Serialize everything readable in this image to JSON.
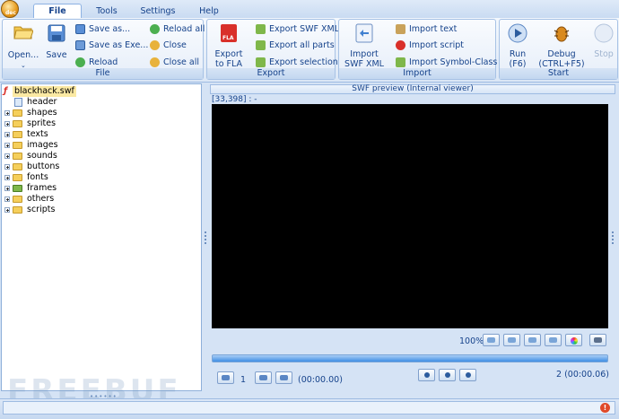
{
  "menu": {
    "tabs": [
      "File",
      "Tools",
      "Settings",
      "Help"
    ]
  },
  "app_logo_text": "dec",
  "ribbon": {
    "file_group": {
      "title": "File",
      "open": "Open...",
      "save": "Save",
      "save_as": "Save as...",
      "save_as_exe": "Save as Exe...",
      "reload": "Reload",
      "reload_all": "Reload all",
      "close": "Close",
      "close_all": "Close all"
    },
    "export_group": {
      "title": "Export",
      "export_fla_line1": "Export",
      "export_fla_line2": "to FLA",
      "fla_badge": "FLA",
      "export_swf_xml": "Export SWF XML",
      "export_all_parts": "Export all parts",
      "export_selection": "Export selection"
    },
    "import_group": {
      "title": "Import",
      "import_swf_xml_line1": "Import",
      "import_swf_xml_line2": "SWF XML",
      "import_text": "Import text",
      "import_script": "Import script",
      "import_symbol_class": "Import Symbol-Class"
    },
    "start_group": {
      "title": "Start",
      "run_line1": "Run",
      "run_line2": "(F6)",
      "debug_line1": "Debug",
      "debug_line2": "(CTRL+F5)",
      "stop": "Stop"
    }
  },
  "tree": {
    "root": "blackhack.swf",
    "items": [
      "header",
      "shapes",
      "sprites",
      "texts",
      "images",
      "sounds",
      "buttons",
      "fonts",
      "frames",
      "others",
      "scripts"
    ]
  },
  "preview": {
    "header": "SWF preview (Internal viewer)",
    "coords": "[33,398] : -",
    "zoom": "100%",
    "frame_number": "1",
    "time_left": "(00:00.00)",
    "frame_info": "2 (00:00.06)"
  },
  "watermark": "FREEBUF",
  "colors": {
    "accent": "#15428b",
    "canvas": "#000000",
    "progress": "#3f8fe4"
  }
}
